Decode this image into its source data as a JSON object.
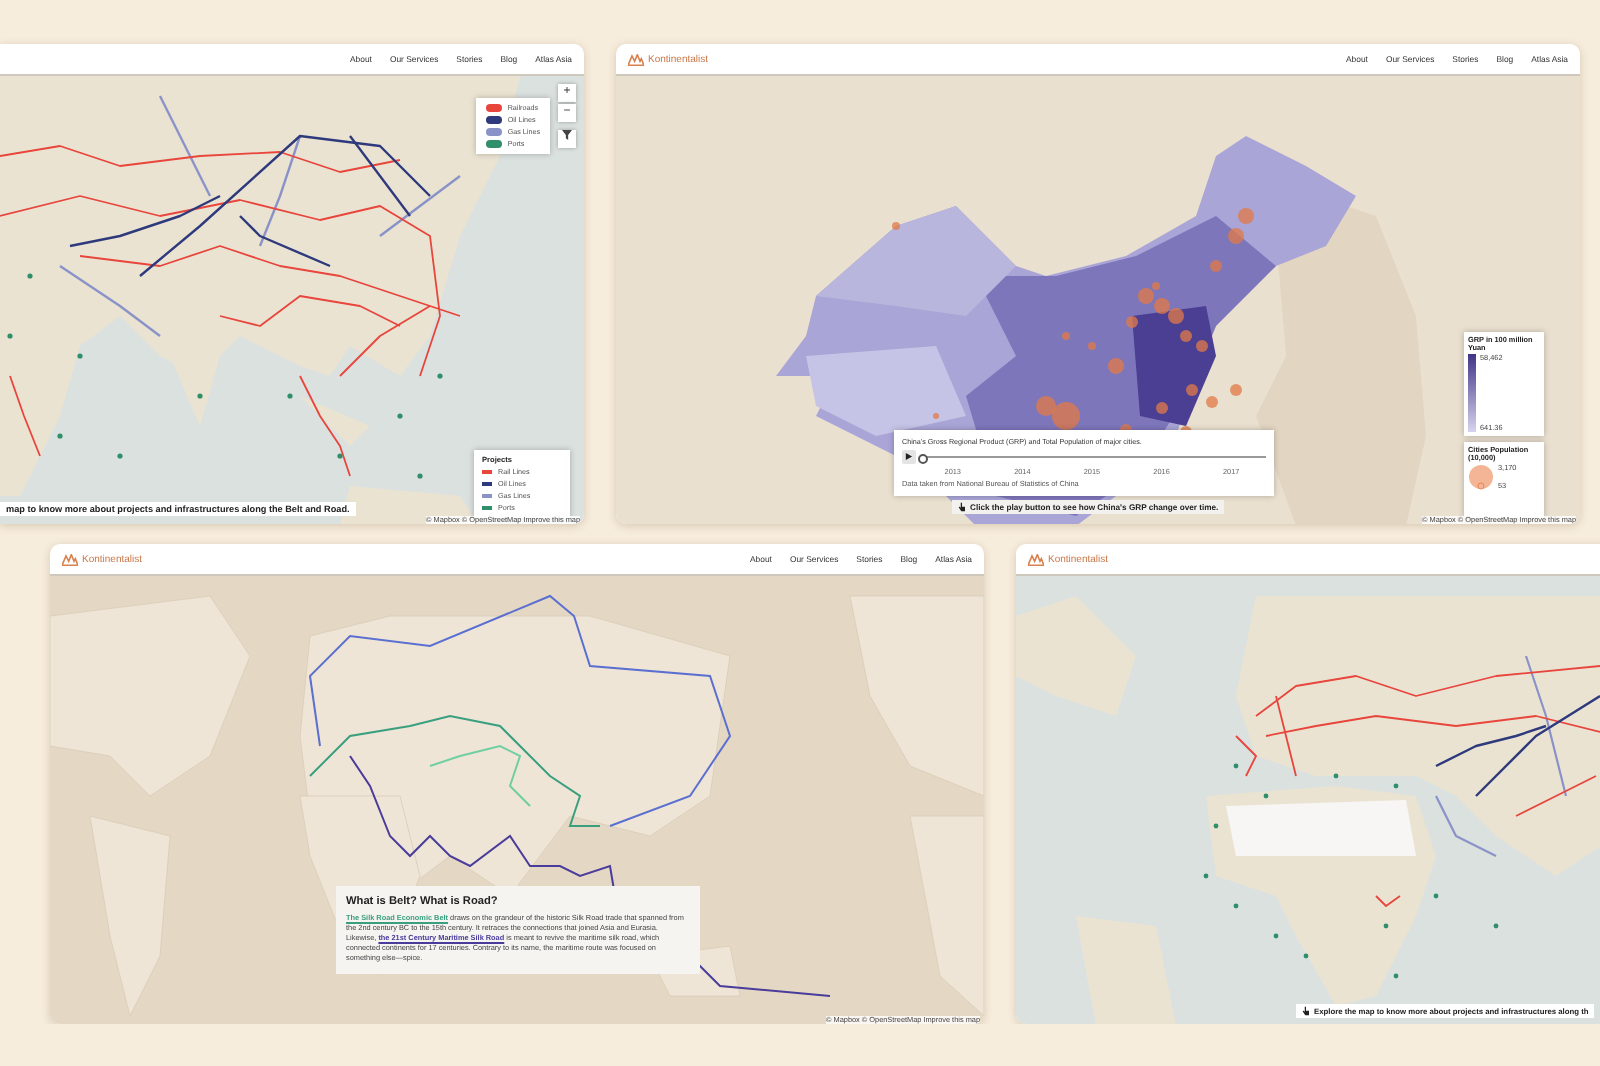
{
  "rail_map_asia": {
    "nav": [
      "About",
      "Our Services",
      "Stories",
      "Blog",
      "Atlas Asia"
    ],
    "zoom_controls": [
      "+",
      "−"
    ],
    "legend": [
      {
        "label": "Railroads",
        "color": "#e8453c"
      },
      {
        "label": "Oil Lines",
        "color": "#2e3a7c"
      },
      {
        "label": "Gas Lines",
        "color": "#8a93c8"
      },
      {
        "label": "Ports",
        "color": "#2f8f6b"
      }
    ],
    "projects_legend": {
      "title": "Projects",
      "items": [
        {
          "label": "Rail Lines",
          "color": "#e8453c"
        },
        {
          "label": "Oil Lines",
          "color": "#2e3a7c"
        },
        {
          "label": "Gas Lines",
          "color": "#8a93c8"
        },
        {
          "label": "Ports",
          "color": "#2f8f6b"
        }
      ]
    },
    "caption": "map to know more about projects and infrastructures along the Belt and Road.",
    "attribution": "© Mapbox © OpenStreetMap Improve this map"
  },
  "china_grp_map": {
    "logo": "Kontinentalist",
    "nav": [
      "About",
      "Our Services",
      "Stories",
      "Blog",
      "Atlas Asia"
    ],
    "timeline": {
      "title": "China's Gross Regional Product (GRP) and Total Population of major cities.",
      "level": 0,
      "ticks": [
        "2013",
        "2014",
        "2015",
        "2016",
        "2017"
      ],
      "source": "Data taken from National Bureau of Statistics of China"
    },
    "callout": "Click the play button to see how China's GRP change over time.",
    "grp_legend": {
      "title": "GRP in 100 million Yuan",
      "max": "58,462",
      "min": "641.36"
    },
    "population_legend": {
      "title": "Cities Population (10,000)",
      "max": "3,170",
      "min": "53"
    },
    "attribution": "© Mapbox © OpenStreetMap Improve this map"
  },
  "belt_road_intro": {
    "logo": "Kontinentalist",
    "nav": [
      "About",
      "Our Services",
      "Stories",
      "Blog",
      "Atlas Asia"
    ],
    "card": {
      "title": "What is Belt? What is Road?",
      "paragraph": [
        {
          "kind": "link",
          "text": "The Silk Road Economic Belt",
          "color": "#3a9f7f"
        },
        {
          "kind": "text",
          "text": " draws on the grandeur of the historic Silk Road trade that spanned from the 2nd century BC to the 15th century. It retraces the connections that joined Asia and Eurasia. Likewise, "
        },
        {
          "kind": "link",
          "text": "the 21st Century Maritime Silk Road",
          "color": "#4a3c9a"
        },
        {
          "kind": "text",
          "text": " is meant to revive the maritime silk road, which connected continents for 17 centuries. Contrary to its name, the maritime route was focused on something else—spice."
        }
      ]
    },
    "attribution": "© Mapbox © OpenStreetMap Improve this map"
  },
  "rail_map_world": {
    "logo": "Kontinentalist",
    "caption": "Explore the map to know more about projects and infrastructures along th"
  }
}
